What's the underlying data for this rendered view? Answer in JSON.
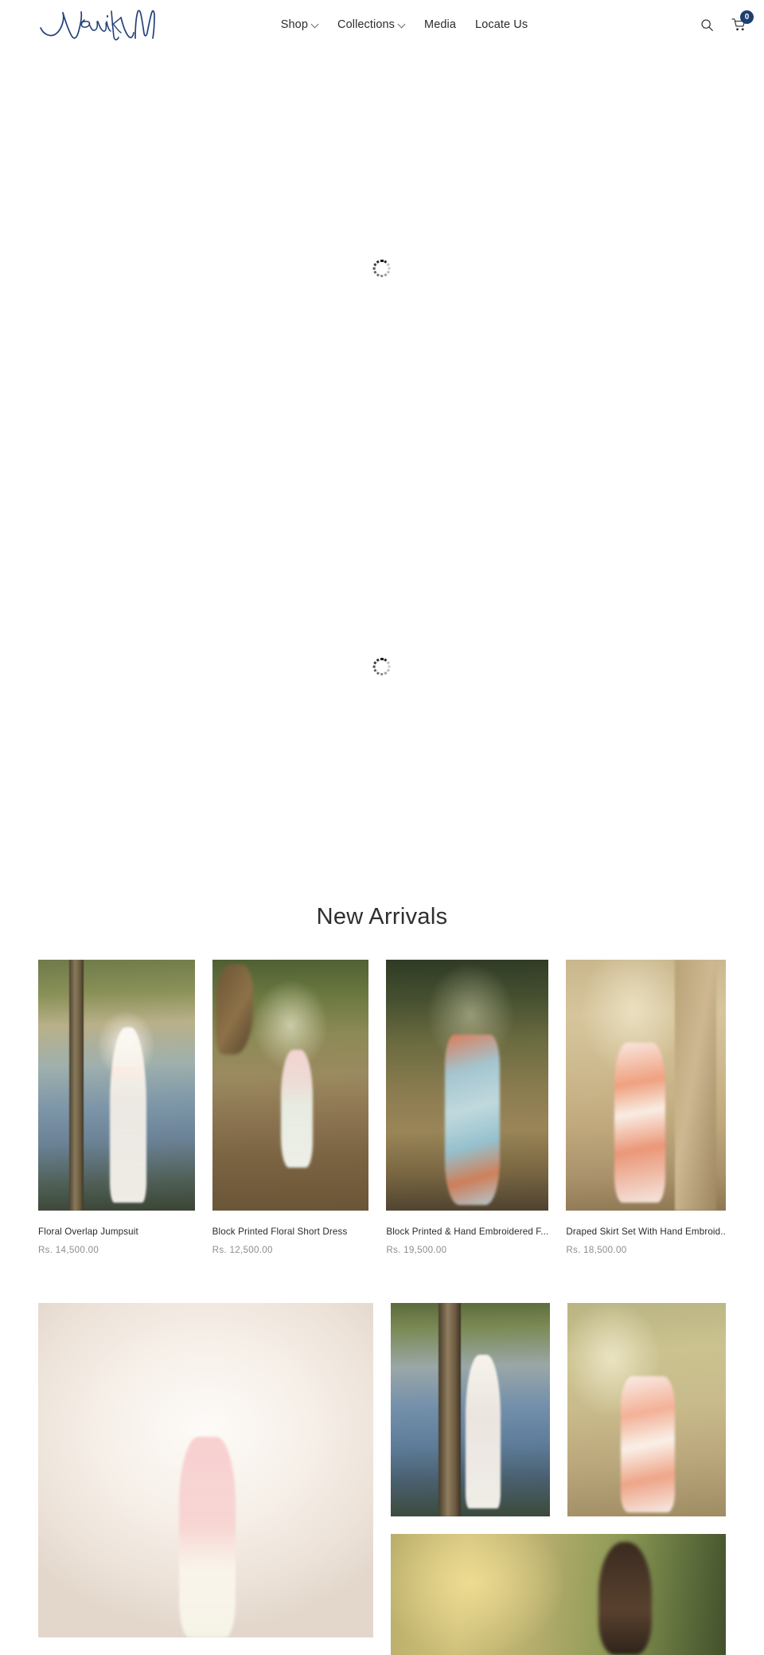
{
  "brand": {
    "name": "Vedika M",
    "logo_color": "#23407a"
  },
  "header": {
    "nav": [
      {
        "label": "Shop",
        "has_dropdown": true
      },
      {
        "label": "Collections",
        "has_dropdown": true
      },
      {
        "label": "Media",
        "has_dropdown": false
      },
      {
        "label": "Locate Us",
        "has_dropdown": false
      }
    ],
    "search_icon": "search-icon",
    "cart_icon": "cart-icon",
    "cart_count": "0",
    "cart_badge_color": "#1d3f6e"
  },
  "hero": {
    "slot_1_state": "loading",
    "slot_2_state": "loading",
    "spinner_icon": "loading-spinner-icon"
  },
  "new_arrivals": {
    "title": "New Arrivals",
    "products": [
      {
        "title": "Floral Overlap Jumpsuit",
        "price": "Rs. 14,500.00",
        "image_alt": "Model in white floral overlap jumpsuit with coral sash by a lake"
      },
      {
        "title": "Block Printed Floral Short Dress",
        "price": "Rs. 12,500.00",
        "image_alt": "Model in pink and mint block printed short dress in a forest"
      },
      {
        "title": "Block Printed & Hand Embroidered F...",
        "price": "Rs. 19,500.00",
        "image_alt": "Model in blue and coral strapless printed dress"
      },
      {
        "title": "Draped Skirt Set With Hand Embroid..",
        "price": "Rs. 18,500.00",
        "image_alt": "Model in coral and white draped skirt set beside a tree"
      }
    ]
  },
  "lookbook": {
    "tiles": [
      {
        "image_alt": "Model in pink halter top and printed skirt by a hazy river"
      },
      {
        "image_alt": "Model in white floral long dress leaning on a tree by the water"
      },
      {
        "image_alt": "Model in coral crop top and printed skirt in sunlight"
      },
      {
        "image_alt": "Model among golden foliage, wide banner image"
      }
    ]
  }
}
